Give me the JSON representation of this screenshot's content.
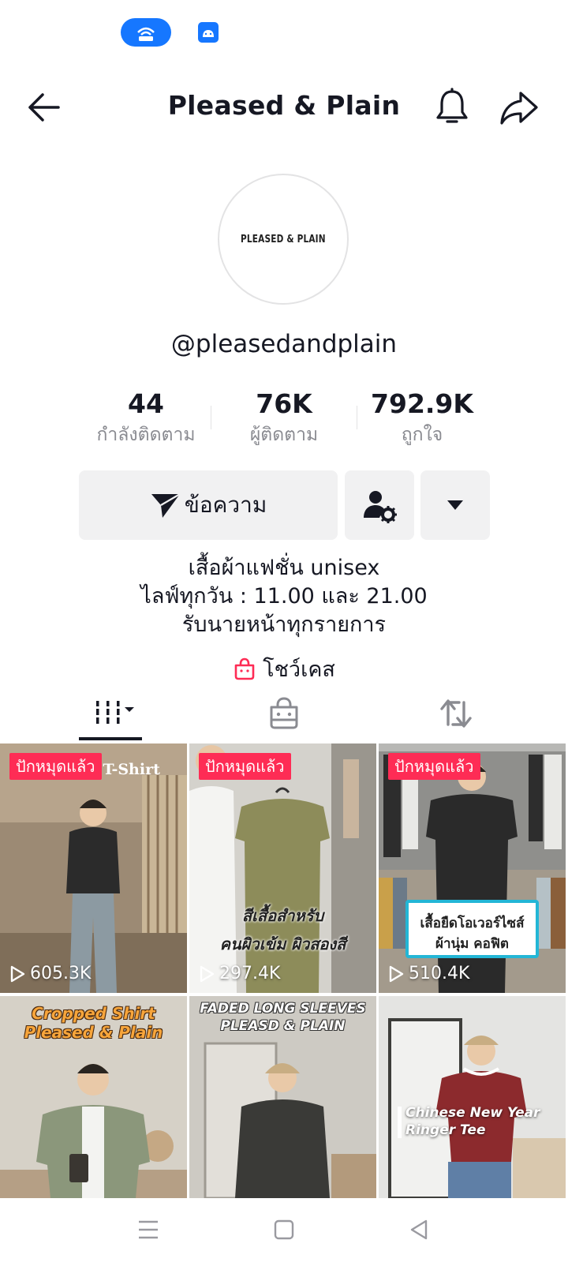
{
  "app": {
    "title": "Pleased & Plain",
    "username": "@pleasedandplain",
    "avatar_text": "PLEASED & PLAIN"
  },
  "stats": [
    {
      "value": "44",
      "label": "กำลังติดตาม"
    },
    {
      "value": "76K",
      "label": "ผู้ติดตาม"
    },
    {
      "value": "792.9K",
      "label": "ถูกใจ"
    }
  ],
  "actions": {
    "message_label": "ข้อความ"
  },
  "bio": {
    "line1": "เสื้อผ้าแฟชั่น unisex",
    "line2": "ไลฟ์ทุกวัน : 11.00 และ 21.00",
    "line3": "รับนายหน้าทุกรายการ"
  },
  "showcase_label": "โชว์เคส",
  "videos": [
    {
      "badge": "ปักหมุดแล้ว",
      "views": "605.3K",
      "caption": "Cropped T-Shirt",
      "colors": [
        "#a58e76",
        "#3a3a3a"
      ]
    },
    {
      "badge": "ปักหมุดแล้ว",
      "views": "297.4K",
      "caption_line1": "สีเสื้อสำหรับ",
      "caption_line2": "คนผิวเข้ม ผิวสองสี",
      "colors": [
        "#d8d6d0",
        "#8a8b5c"
      ]
    },
    {
      "badge": "ปักหมุดแล้ว",
      "views": "510.4K",
      "caption_line1": "เสื้อยืดโอเวอร์ไซส์",
      "caption_line2": "ผ้านุ่ม คอฟิต",
      "colors": [
        "#b9b9b6",
        "#2b2b2b"
      ]
    },
    {
      "caption_line1": "Cropped Shirt",
      "caption_line2": "Pleased & Plain",
      "colors": [
        "#d7d2c8",
        "#8c987c"
      ]
    },
    {
      "caption_line1": "FADED LONG SLEEVES",
      "caption_line2": "PLEASD & PLAIN",
      "colors": [
        "#c9c6bf",
        "#3b3b38"
      ]
    },
    {
      "caption_line1": "Chinese New Year",
      "caption_line2": "Ringer Tee",
      "colors": [
        "#e6e6e6",
        "#8e2a2c"
      ]
    }
  ],
  "colors": {
    "accent": "#fe2c55",
    "button_bg": "#f1f1f2",
    "status_blue": "#1677ff"
  }
}
